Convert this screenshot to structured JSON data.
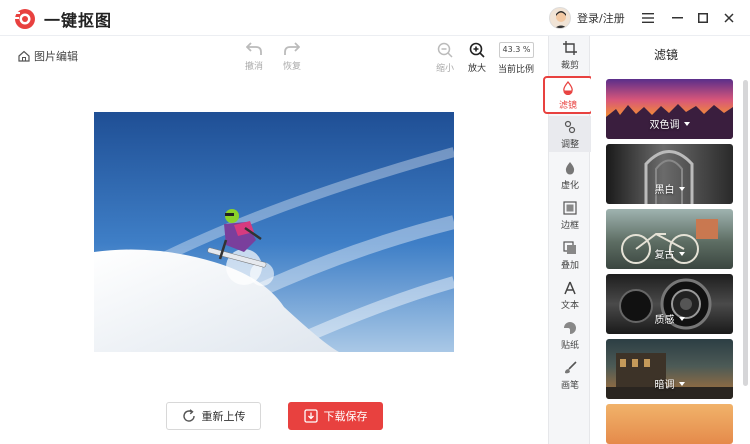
{
  "app": {
    "title": "一键抠图",
    "login_label": "登录/注册"
  },
  "breadcrumb": {
    "label": "图片编辑"
  },
  "toolbar": {
    "undo_label": "撤消",
    "redo_label": "恢复",
    "zoom_out_label": "缩小",
    "zoom_in_label": "放大",
    "zoom_value": "43.3 %",
    "ratio_label": "当前比例"
  },
  "actions": {
    "reupload_label": "重新上传",
    "download_label": "下载保存"
  },
  "rail": {
    "items": [
      {
        "label": "裁剪",
        "icon": "crop-icon"
      },
      {
        "label": "滤镜",
        "icon": "filter-drop-icon"
      },
      {
        "label": "调整",
        "icon": "adjust-icon"
      },
      {
        "label": "虚化",
        "icon": "blur-drop-icon"
      },
      {
        "label": "边框",
        "icon": "frame-icon"
      },
      {
        "label": "叠加",
        "icon": "overlay-icon"
      },
      {
        "label": "文本",
        "icon": "text-icon"
      },
      {
        "label": "贴纸",
        "icon": "sticker-icon"
      },
      {
        "label": "画笔",
        "icon": "brush-icon"
      }
    ]
  },
  "panel": {
    "title": "滤镜",
    "filters": [
      {
        "label": "双色调"
      },
      {
        "label": "黑白"
      },
      {
        "label": "复古"
      },
      {
        "label": "质感"
      },
      {
        "label": "暗调"
      }
    ]
  },
  "colors": {
    "accent": "#e8413f",
    "rail_bg": "#f5f6f8"
  }
}
